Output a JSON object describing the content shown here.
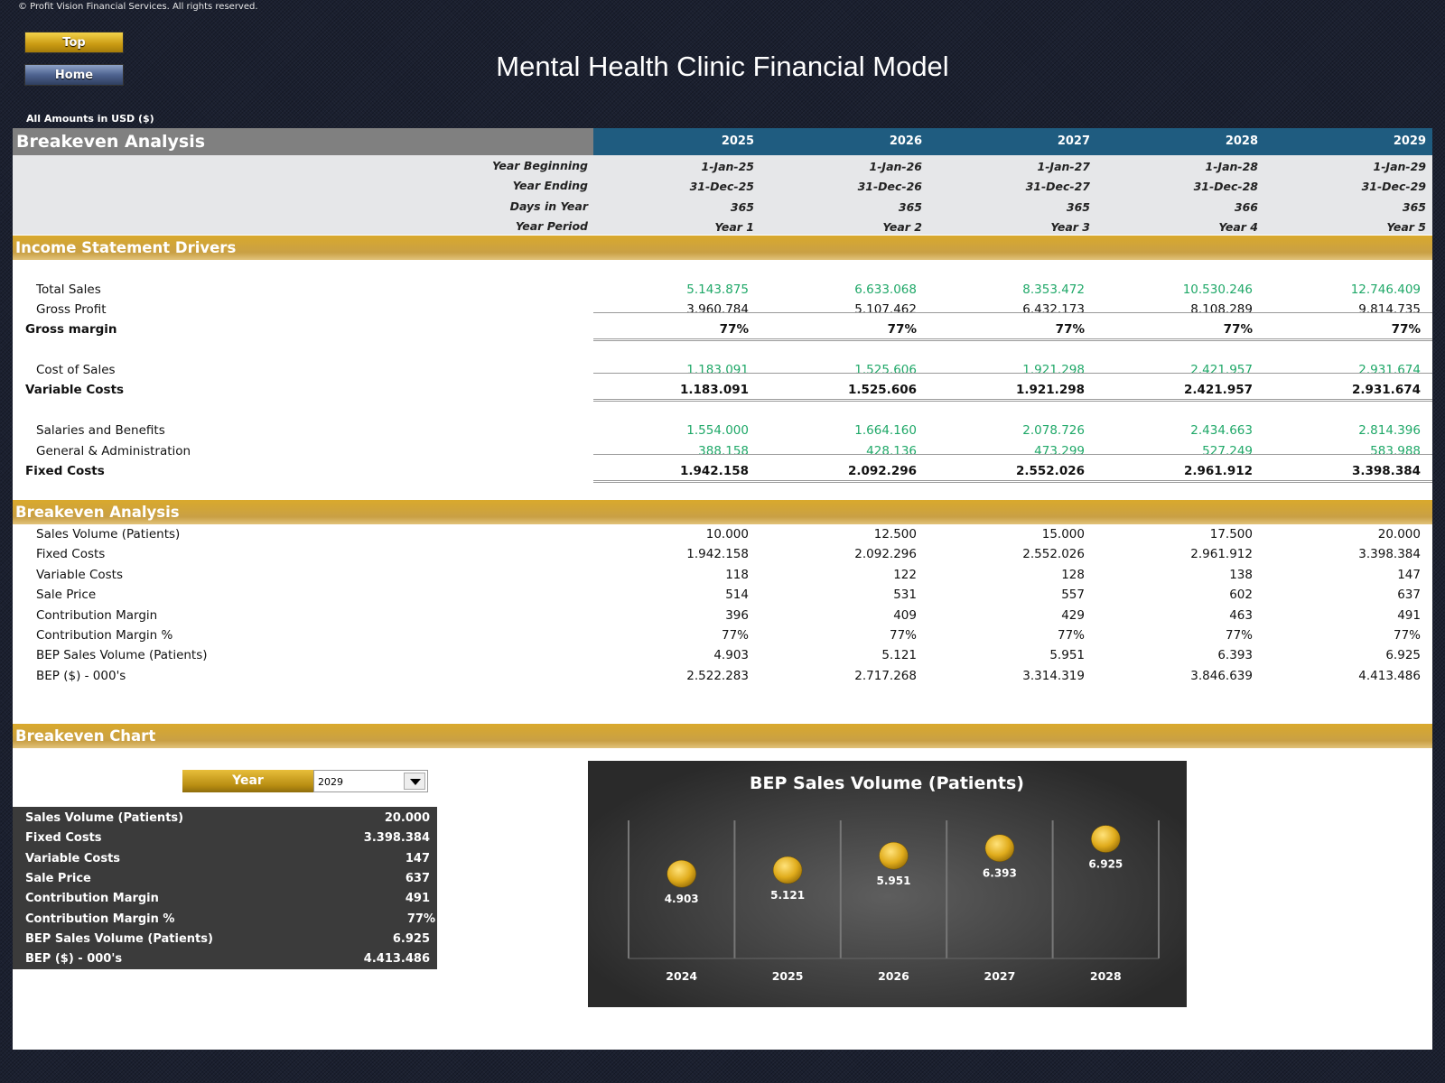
{
  "copyright": "© Profit Vision Financial Services. All rights reserved.",
  "nav": {
    "top_label": "Top",
    "home_label": "Home"
  },
  "title": "Mental Health Clinic Financial Model",
  "currency_note": "All Amounts in  USD ($)",
  "colors": {
    "header_blue": "#1f5c80",
    "gold": "#d9a92c",
    "green_values": "#1fa868",
    "dark_panel": "#3b3b3b"
  },
  "header": {
    "section": "Breakeven Analysis",
    "years": [
      "2025",
      "2026",
      "2027",
      "2028",
      "2029"
    ]
  },
  "info_rows": [
    {
      "label": "Year Beginning",
      "values": [
        "1-Jan-25",
        "1-Jan-26",
        "1-Jan-27",
        "1-Jan-28",
        "1-Jan-29"
      ]
    },
    {
      "label": "Year Ending",
      "values": [
        "31-Dec-25",
        "31-Dec-26",
        "31-Dec-27",
        "31-Dec-28",
        "31-Dec-29"
      ]
    },
    {
      "label": "Days in Year",
      "values": [
        "365",
        "365",
        "365",
        "366",
        "365"
      ]
    },
    {
      "label": "Year Period",
      "values": [
        "Year 1",
        "Year 2",
        "Year 3",
        "Year 4",
        "Year 5"
      ]
    }
  ],
  "income_section": {
    "title": "Income Statement Drivers",
    "rows": [
      {
        "label": "Total Sales",
        "values": [
          "5.143.875",
          "6.633.068",
          "8.353.472",
          "10.530.246",
          "12.746.409"
        ],
        "style": "input"
      },
      {
        "label": "Gross Profit",
        "values": [
          "3.960.784",
          "5.107.462",
          "6.432.173",
          "8.108.289",
          "9.814.735"
        ],
        "style": "normal"
      },
      {
        "label": "Gross margin",
        "values": [
          "77%",
          "77%",
          "77%",
          "77%",
          "77%"
        ],
        "style": "total"
      },
      {
        "label": "Cost of Sales",
        "values": [
          "1.183.091",
          "1.525.606",
          "1.921.298",
          "2.421.957",
          "2.931.674"
        ],
        "style": "input"
      },
      {
        "label": "Variable Costs",
        "values": [
          "1.183.091",
          "1.525.606",
          "1.921.298",
          "2.421.957",
          "2.931.674"
        ],
        "style": "total"
      },
      {
        "label": "Salaries and Benefits",
        "values": [
          "1.554.000",
          "1.664.160",
          "2.078.726",
          "2.434.663",
          "2.814.396"
        ],
        "style": "input"
      },
      {
        "label": "General & Administration",
        "values": [
          "388.158",
          "428.136",
          "473.299",
          "527.249",
          "583.988"
        ],
        "style": "input"
      },
      {
        "label": "Fixed Costs",
        "values": [
          "1.942.158",
          "2.092.296",
          "2.552.026",
          "2.961.912",
          "3.398.384"
        ],
        "style": "total"
      }
    ]
  },
  "breakeven_section": {
    "title": "Breakeven Analysis",
    "rows": [
      {
        "label": "Sales Volume (Patients)",
        "values": [
          "10.000",
          "12.500",
          "15.000",
          "17.500",
          "20.000"
        ]
      },
      {
        "label": "Fixed Costs",
        "values": [
          "1.942.158",
          "2.092.296",
          "2.552.026",
          "2.961.912",
          "3.398.384"
        ]
      },
      {
        "label": "Variable Costs",
        "values": [
          "118",
          "122",
          "128",
          "138",
          "147"
        ]
      },
      {
        "label": "Sale Price",
        "values": [
          "514",
          "531",
          "557",
          "602",
          "637"
        ]
      },
      {
        "label": "Contribution Margin",
        "values": [
          "396",
          "409",
          "429",
          "463",
          "491"
        ]
      },
      {
        "label": "Contribution Margin %",
        "values": [
          "77%",
          "77%",
          "77%",
          "77%",
          "77%"
        ]
      },
      {
        "label": "BEP Sales Volume (Patients)",
        "values": [
          "4.903",
          "5.121",
          "5.951",
          "6.393",
          "6.925"
        ]
      },
      {
        "label": "BEP ($) - 000's",
        "values": [
          "2.522.283",
          "2.717.268",
          "3.314.319",
          "3.846.639",
          "4.413.486"
        ]
      }
    ]
  },
  "chart_section": {
    "title": "Breakeven Chart",
    "year_label": "Year",
    "year_selected": "2029",
    "summary": [
      {
        "label": "Sales Volume (Patients)",
        "value": "20.000"
      },
      {
        "label": "Fixed Costs",
        "value": "3.398.384"
      },
      {
        "label": "Variable Costs",
        "value": "147"
      },
      {
        "label": "Sale Price",
        "value": "637"
      },
      {
        "label": "Contribution Margin",
        "value": "491"
      },
      {
        "label": "Contribution Margin %",
        "value": "77%"
      },
      {
        "label": "BEP Sales Volume (Patients)",
        "value": "6.925"
      },
      {
        "label": "BEP ($) - 000's",
        "value": "4.413.486"
      }
    ]
  },
  "chart_data": {
    "type": "scatter",
    "title": "BEP Sales Volume (Patients)",
    "categories": [
      "2024",
      "2025",
      "2026",
      "2027",
      "2028"
    ],
    "values": [
      4903,
      5121,
      5951,
      6393,
      6925
    ],
    "data_labels": [
      "4.903",
      "5.121",
      "5.951",
      "6.393",
      "6.925"
    ],
    "ylim": [
      0,
      8000
    ],
    "grid": "vertical category separators",
    "marker_color": "#e0ac1c",
    "xlabel": "",
    "ylabel": ""
  }
}
